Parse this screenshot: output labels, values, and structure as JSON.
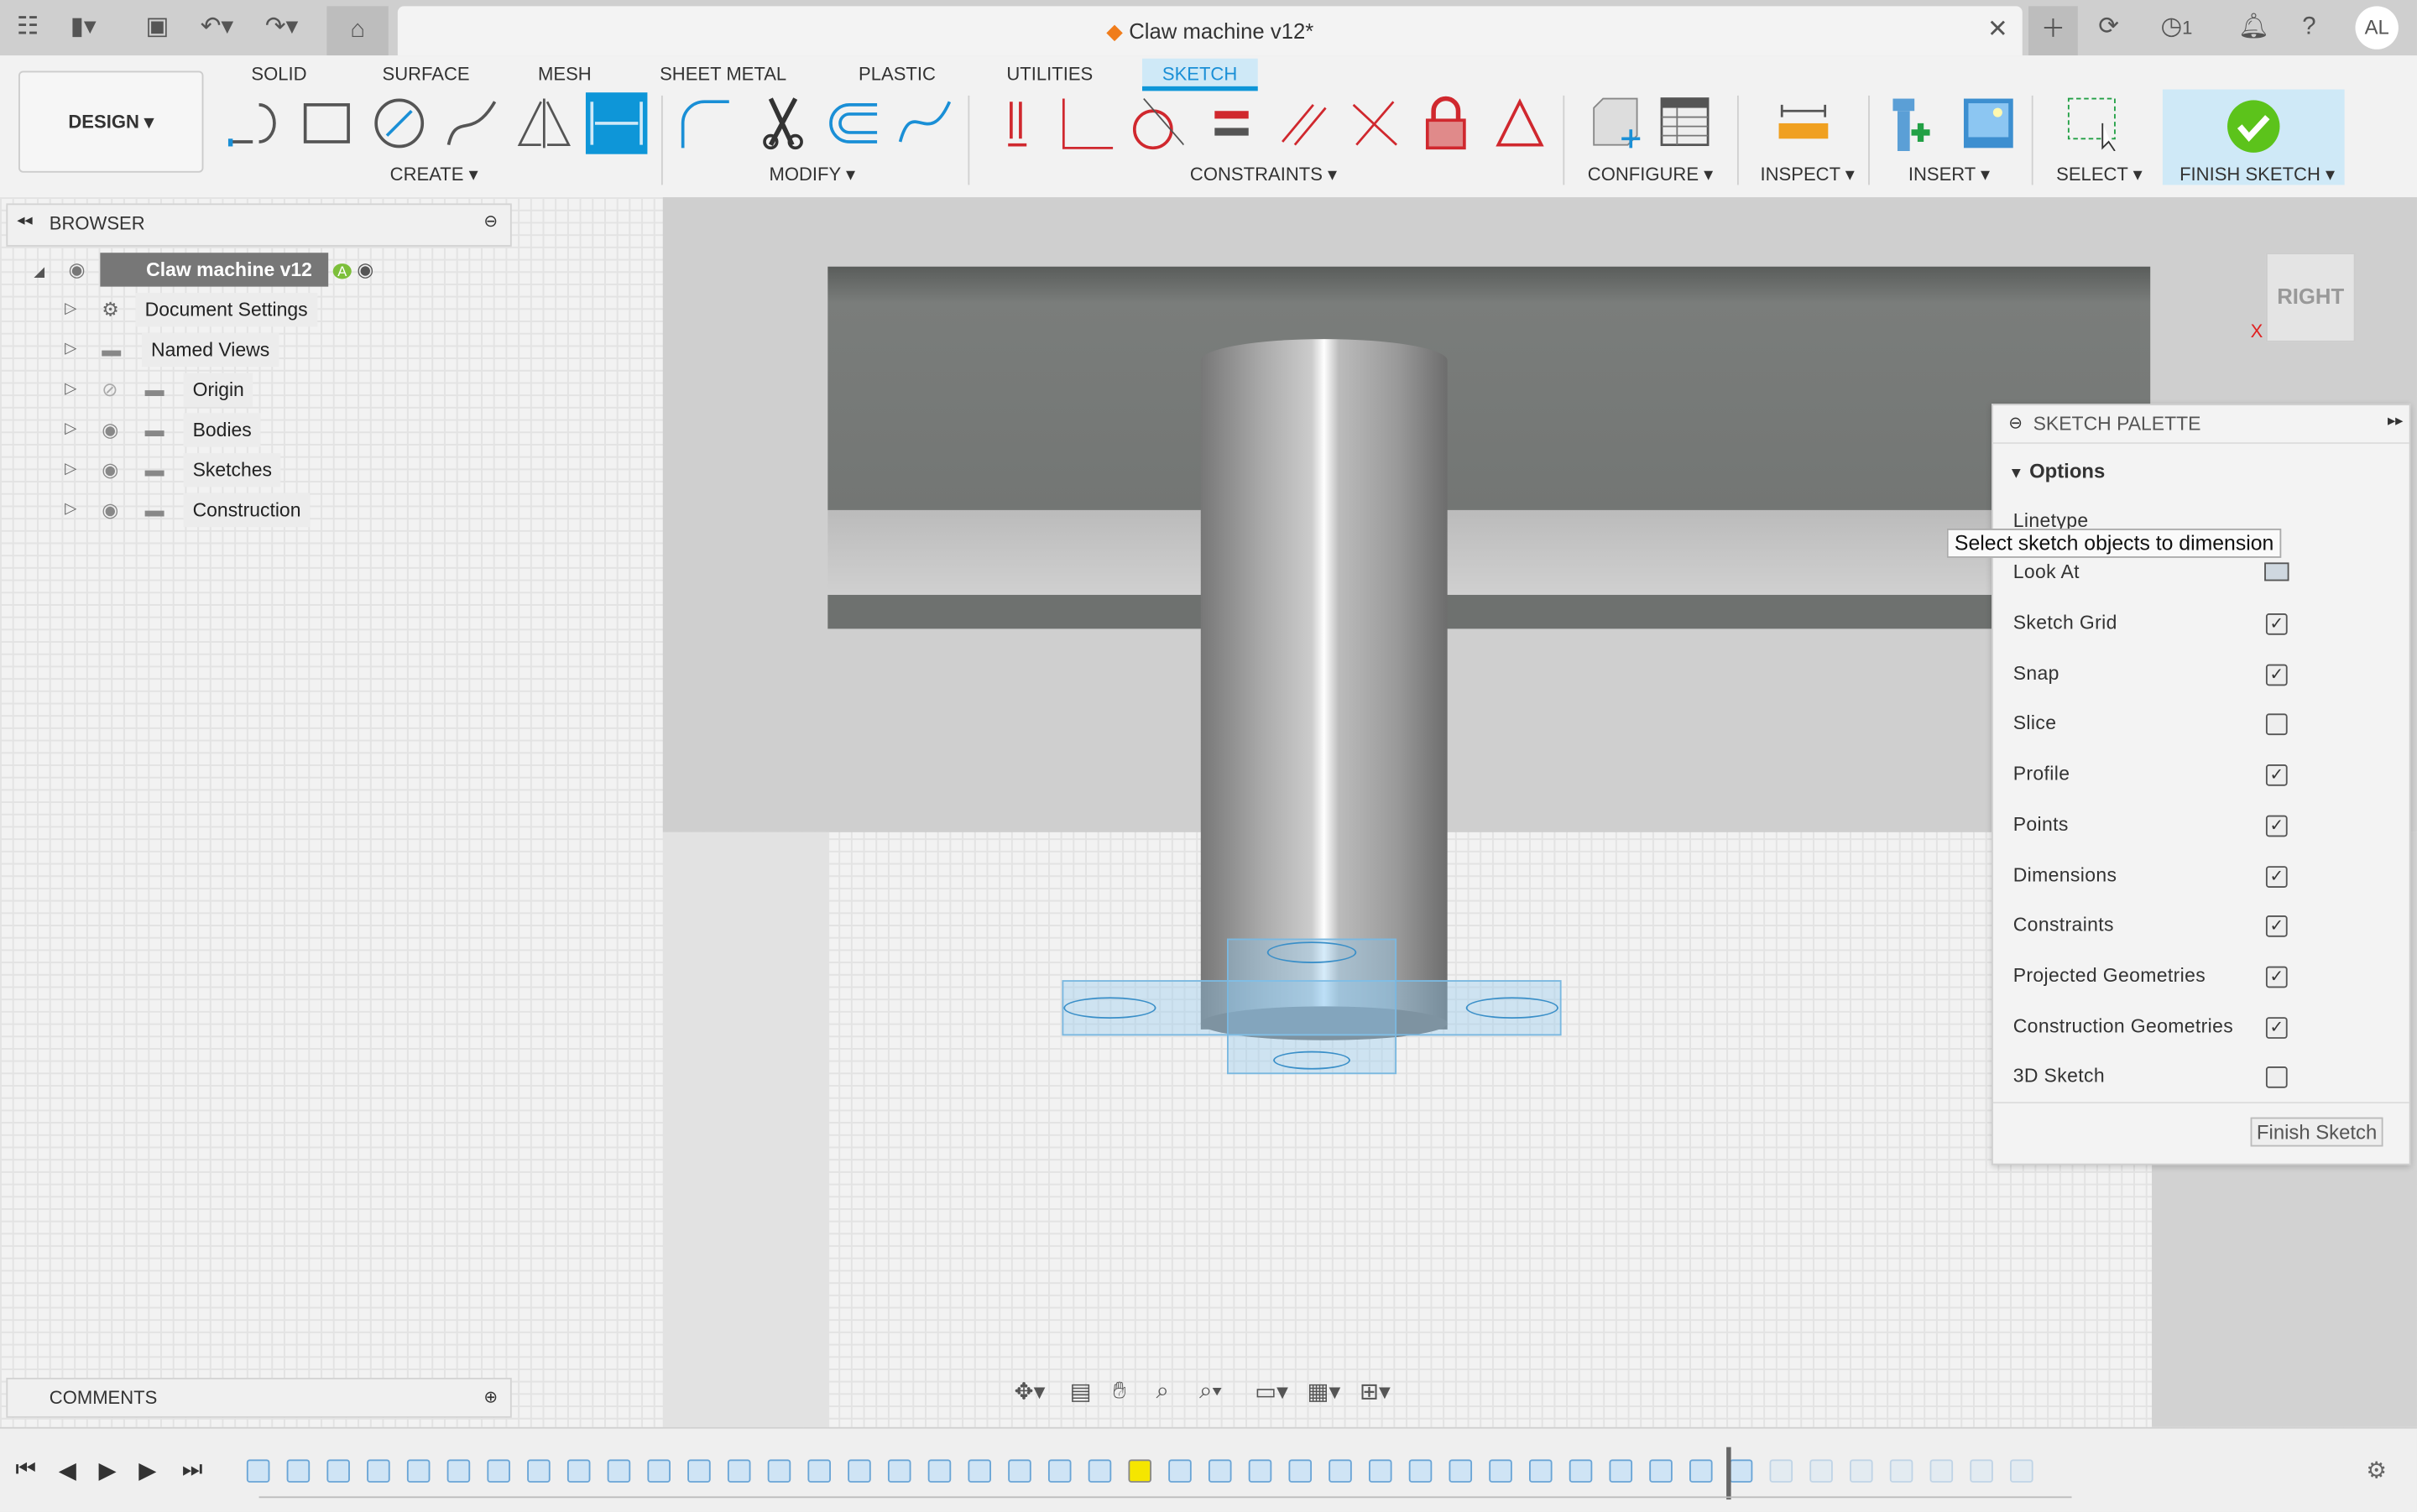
{
  "app": {
    "doc_title": "Claw machine v12*",
    "avatar": "AL",
    "jobs_count": "1"
  },
  "titlebar": {
    "icons": [
      "grid-icon",
      "file-icon",
      "save-icon",
      "undo-icon",
      "redo-icon",
      "home-icon",
      "close-icon",
      "plus-icon",
      "refresh-icon",
      "clock-icon",
      "bell-icon",
      "help-icon"
    ]
  },
  "toolbar": {
    "workspace": "DESIGN ▾",
    "tabs": [
      "SOLID",
      "SURFACE",
      "MESH",
      "SHEET METAL",
      "PLASTIC",
      "UTILITIES",
      "SKETCH"
    ],
    "active_tab": "SKETCH",
    "groups": [
      "CREATE ▾",
      "MODIFY ▾",
      "CONSTRAINTS ▾",
      "CONFIGURE ▾",
      "INSPECT ▾",
      "INSERT ▾",
      "SELECT ▾",
      "FINISH SKETCH ▾"
    ]
  },
  "browser": {
    "title": "BROWSER",
    "root": "Claw machine v12",
    "items": [
      {
        "label": "Document Settings",
        "icon": "gear-icon"
      },
      {
        "label": "Named Views",
        "icon": "folder-icon"
      },
      {
        "label": "Origin",
        "icon": "folder-icon",
        "hidden": true
      },
      {
        "label": "Bodies",
        "icon": "folder-icon"
      },
      {
        "label": "Sketches",
        "icon": "folder-icon"
      },
      {
        "label": "Construction",
        "icon": "folder-icon"
      }
    ]
  },
  "comments": {
    "title": "COMMENTS"
  },
  "viewcube": {
    "face": "RIGHT",
    "axis_x": "X"
  },
  "tooltip": "Select sketch objects to dimension",
  "palette": {
    "title": "SKETCH PALETTE",
    "section": "Options",
    "linetype": "Linetype",
    "look_at": "Look At",
    "options": [
      {
        "label": "Sketch Grid",
        "checked": true
      },
      {
        "label": "Snap",
        "checked": true
      },
      {
        "label": "Slice",
        "checked": false
      },
      {
        "label": "Profile",
        "checked": true
      },
      {
        "label": "Points",
        "checked": true
      },
      {
        "label": "Dimensions",
        "checked": true
      },
      {
        "label": "Constraints",
        "checked": true
      },
      {
        "label": "Projected Geometries",
        "checked": true
      },
      {
        "label": "Construction Geometries",
        "checked": true
      },
      {
        "label": "3D Sketch",
        "checked": false
      }
    ],
    "finish": "Finish Sketch"
  },
  "colors": {
    "accent": "#0e96d8",
    "finish_green": "#5cc31b",
    "constraint_red": "#d0282e"
  }
}
